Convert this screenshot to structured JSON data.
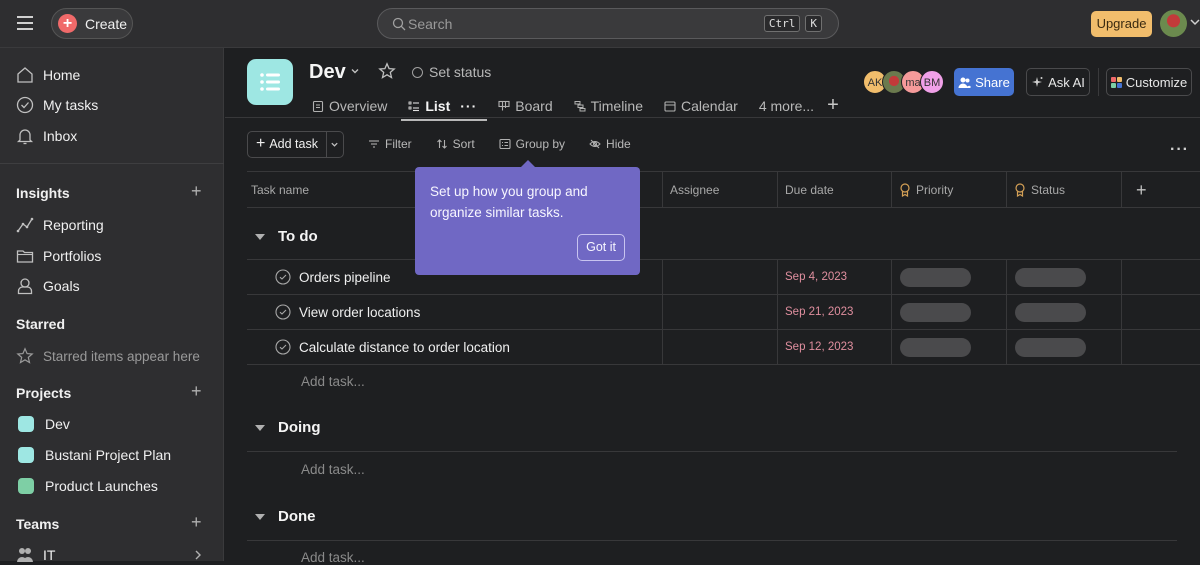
{
  "topbar": {
    "create_label": "Create",
    "search_placeholder": "Search",
    "shortcut_keys": [
      "Ctrl",
      "K"
    ],
    "upgrade_label": "Upgrade"
  },
  "sidebar": {
    "nav": [
      {
        "label": "Home",
        "icon": "home-icon"
      },
      {
        "label": "My tasks",
        "icon": "check-circle-icon"
      },
      {
        "label": "Inbox",
        "icon": "bell-icon"
      }
    ],
    "insights": {
      "heading": "Insights",
      "items": [
        {
          "label": "Reporting",
          "icon": "chart-line-icon"
        },
        {
          "label": "Portfolios",
          "icon": "folder-icon"
        },
        {
          "label": "Goals",
          "icon": "person-icon"
        }
      ]
    },
    "starred": {
      "heading": "Starred",
      "hint": "Starred items appear here"
    },
    "projects": {
      "heading": "Projects",
      "items": [
        {
          "label": "Dev",
          "color": "#9ee7e3"
        },
        {
          "label": "Bustani Project Plan",
          "color": "#9ee7e3"
        },
        {
          "label": "Product Launches",
          "color": "#7ecfa5"
        }
      ]
    },
    "teams": {
      "heading": "Teams",
      "items": [
        {
          "label": "IT"
        }
      ]
    }
  },
  "project": {
    "title": "Dev",
    "set_status_label": "Set status",
    "tabs": [
      {
        "label": "Overview",
        "icon": "clipboard-icon"
      },
      {
        "label": "List",
        "icon": "list-icon",
        "active": true
      },
      {
        "label": "Board",
        "icon": "board-icon"
      },
      {
        "label": "Timeline",
        "icon": "timeline-icon"
      },
      {
        "label": "Calendar",
        "icon": "calendar-icon"
      },
      {
        "label": "4 more..."
      }
    ],
    "members": [
      {
        "initials": "AK",
        "color": "#f1bd6c"
      },
      {
        "initials": "",
        "color": "#7a5a3a"
      },
      {
        "initials": "ma",
        "color": "#f59a9a"
      },
      {
        "initials": "BM",
        "color": "#f0a0e8"
      }
    ],
    "share_label": "Share",
    "ask_ai_label": "Ask AI",
    "customize_label": "Customize"
  },
  "toolbar": {
    "add_task_label": "Add task",
    "filter_label": "Filter",
    "sort_label": "Sort",
    "group_by_label": "Group by",
    "hide_label": "Hide"
  },
  "columns": [
    "Task name",
    "Assignee",
    "Due date",
    "Priority",
    "Status"
  ],
  "sections": [
    {
      "title": "To do",
      "tasks": [
        {
          "name": "Orders pipeline",
          "due": "Sep 4, 2023"
        },
        {
          "name": "View order locations",
          "due": "Sep 21, 2023"
        },
        {
          "name": "Calculate distance to order location",
          "due": "Sep 12, 2023"
        }
      ],
      "add_task_label": "Add task..."
    },
    {
      "title": "Doing",
      "tasks": [],
      "add_task_label": "Add task..."
    },
    {
      "title": "Done",
      "tasks": [],
      "add_task_label": "Add task..."
    }
  ],
  "tooltip": {
    "text": "Set up how you group and organize similar tasks.",
    "button_label": "Got it"
  },
  "colors": {
    "accent_purple": "#7068c4",
    "share_blue": "#4573d2",
    "upgrade_yellow": "#f1bd6c",
    "due_date_red": "#e08f9f",
    "create_red": "#f06a6a"
  }
}
